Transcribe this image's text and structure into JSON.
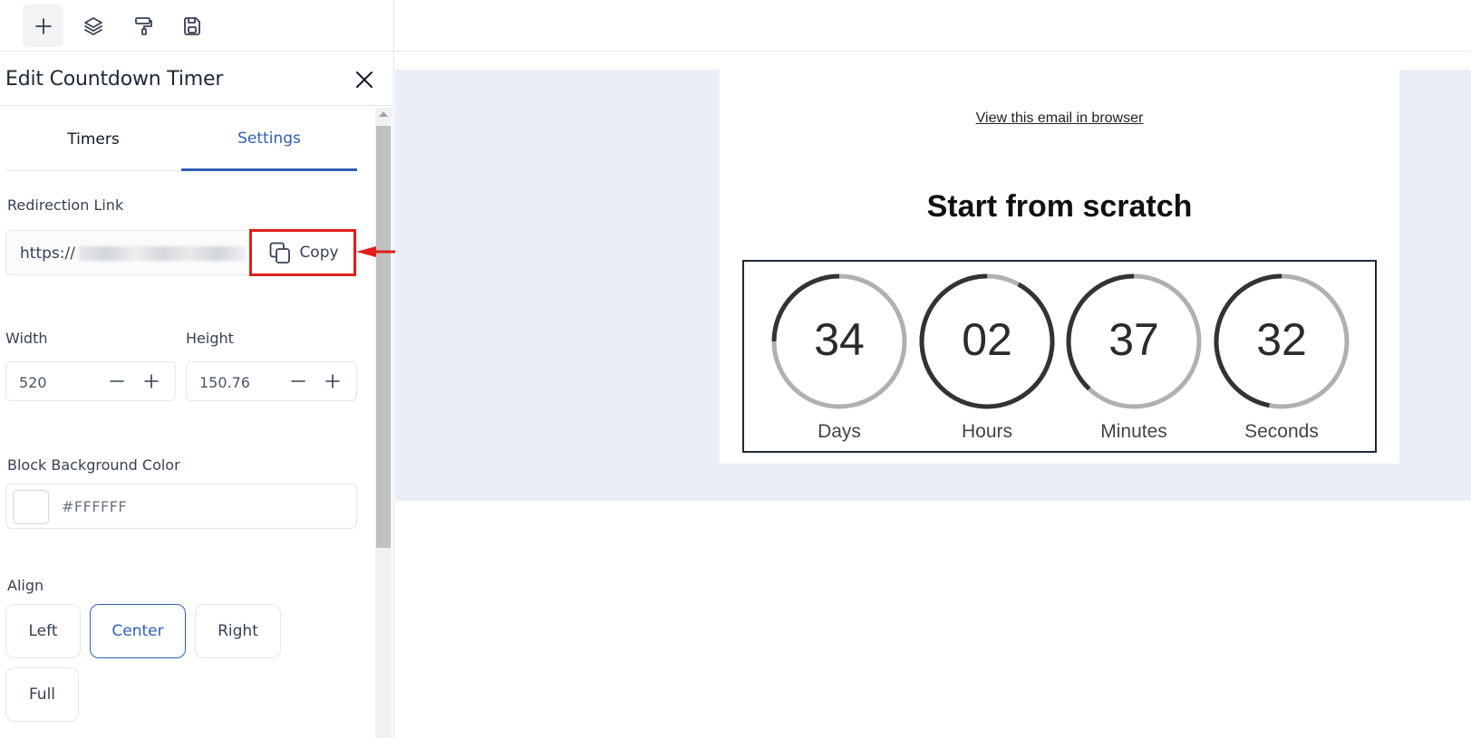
{
  "toolbar": {
    "buttons": [
      {
        "name": "add",
        "icon": "plus-icon"
      },
      {
        "name": "layers",
        "icon": "layers-icon"
      },
      {
        "name": "paint",
        "icon": "paint-roller-icon"
      },
      {
        "name": "save",
        "icon": "save-icon"
      }
    ]
  },
  "panel": {
    "title": "Edit Countdown Timer",
    "tabs": [
      {
        "label": "Timers"
      },
      {
        "label": "Settings"
      }
    ],
    "active_tab": "Settings",
    "redirection": {
      "label": "Redirection Link",
      "value": "https://",
      "copy_label": "Copy"
    },
    "width": {
      "label": "Width",
      "value": "520"
    },
    "height": {
      "label": "Height",
      "value": "150.76"
    },
    "bg_color": {
      "label": "Block Background Color",
      "value": "#FFFFFF"
    },
    "align": {
      "label": "Align",
      "options": [
        "Left",
        "Center",
        "Right",
        "Full"
      ],
      "selected": "Center"
    }
  },
  "email": {
    "view_link": "View this email in browser",
    "headline": "Start from scratch",
    "timer": [
      {
        "value": "34",
        "label": "Days",
        "progress": 0.25
      },
      {
        "value": "02",
        "label": "Hours",
        "progress": 0.92
      },
      {
        "value": "37",
        "label": "Minutes",
        "progress": 0.38
      },
      {
        "value": "32",
        "label": "Seconds",
        "progress": 0.47
      }
    ]
  },
  "colors": {
    "accent": "#2f5fb3",
    "annotation": "#e11d1d",
    "canvas_bg": "#eaeef5",
    "ring_track": "#b0b0b0",
    "ring_fill": "#333333"
  }
}
